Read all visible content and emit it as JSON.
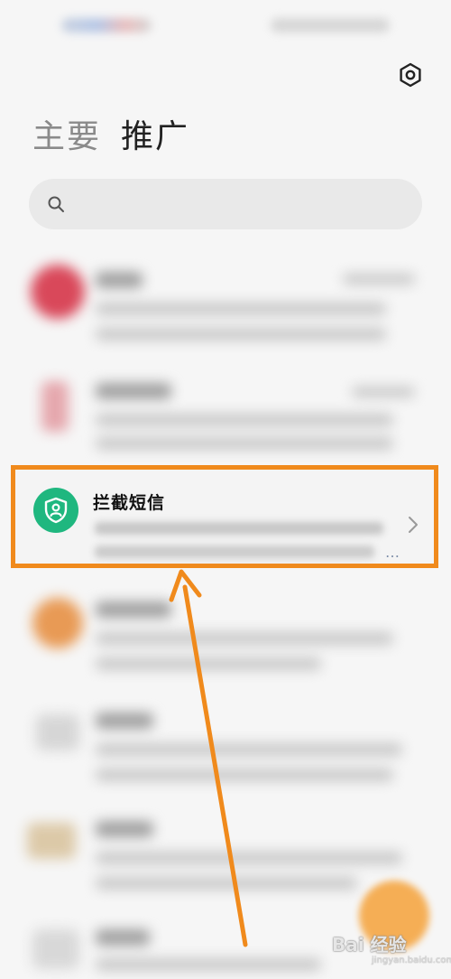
{
  "tabs": [
    {
      "label": "主要",
      "active": false
    },
    {
      "label": "推广",
      "active": true
    }
  ],
  "search": {
    "placeholder": ""
  },
  "intercepted": {
    "title": "拦截短信",
    "ellipsis": "…"
  },
  "watermark": {
    "text": "Bai 经验",
    "sub": "jingyan.baidu.com"
  },
  "colors": {
    "highlight": "#f08a1c",
    "shield_avatar": "#1fb77f",
    "fab": "#f5a23a"
  },
  "icons": {
    "settings": "gear-icon",
    "search": "search-icon",
    "intercept": "shield-user-icon",
    "open": "chevron-right-icon"
  }
}
